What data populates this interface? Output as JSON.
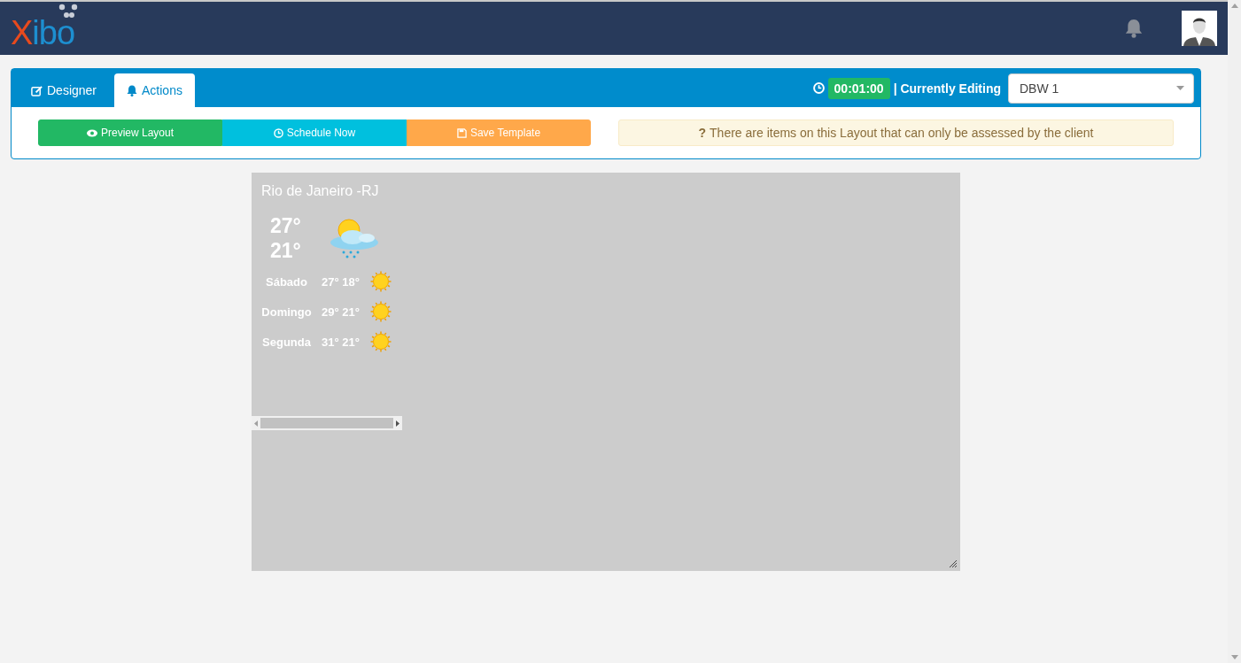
{
  "navbar": {
    "logo": {
      "first": "X",
      "rest": "ibo"
    }
  },
  "tabs": [
    {
      "label": "Designer",
      "kind": "edit",
      "selected": false
    },
    {
      "label": "Actions",
      "kind": "bell",
      "selected": true
    }
  ],
  "duration": "00:01:00",
  "editing_label": "| Currently Editing",
  "layout_select": {
    "value": "DBW 1"
  },
  "buttons": [
    {
      "label": "Preview Layout",
      "kind": "preview"
    },
    {
      "label": "Schedule Now",
      "kind": "schedule"
    },
    {
      "label": "Save Template",
      "kind": "save"
    }
  ],
  "alert": {
    "mark": "?",
    "text": "There are items on this Layout that can only be assessed by the client"
  },
  "weather": {
    "city": "Rio de Janeiro -RJ",
    "high": "27°",
    "low": "21°",
    "forecast": [
      {
        "day": "Sábado",
        "temps": "27° 18°"
      },
      {
        "day": "Domingo",
        "temps": "29° 21°"
      },
      {
        "day": "Segunda",
        "temps": "31° 21°"
      }
    ]
  }
}
